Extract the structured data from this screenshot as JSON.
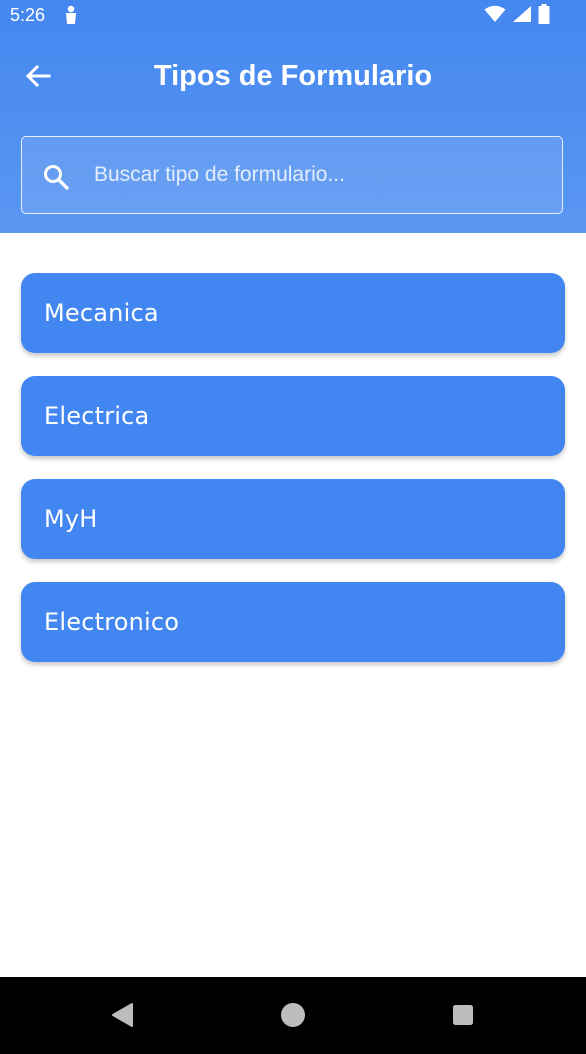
{
  "status_bar": {
    "time": "5:26",
    "icons": [
      "notification-icon",
      "wifi-icon",
      "signal-icon",
      "battery-icon"
    ]
  },
  "app_bar": {
    "title": "Tipos de Formulario",
    "back_icon": "arrow-back-icon"
  },
  "search": {
    "placeholder": "Buscar tipo de formulario...",
    "value": "",
    "icon": "search-icon"
  },
  "form_types": [
    {
      "label": "Mecanica"
    },
    {
      "label": "Electrica"
    },
    {
      "label": "MyH"
    },
    {
      "label": "Electronico"
    }
  ],
  "nav_bar": {
    "icons": [
      "nav-back-icon",
      "nav-home-icon",
      "nav-recents-icon"
    ]
  },
  "colors": {
    "header_top": "#4487f0",
    "header_bottom": "#5b97f2",
    "card": "#4286f1",
    "nav_bar": "#000000",
    "nav_icons": "#bdbdbd"
  }
}
